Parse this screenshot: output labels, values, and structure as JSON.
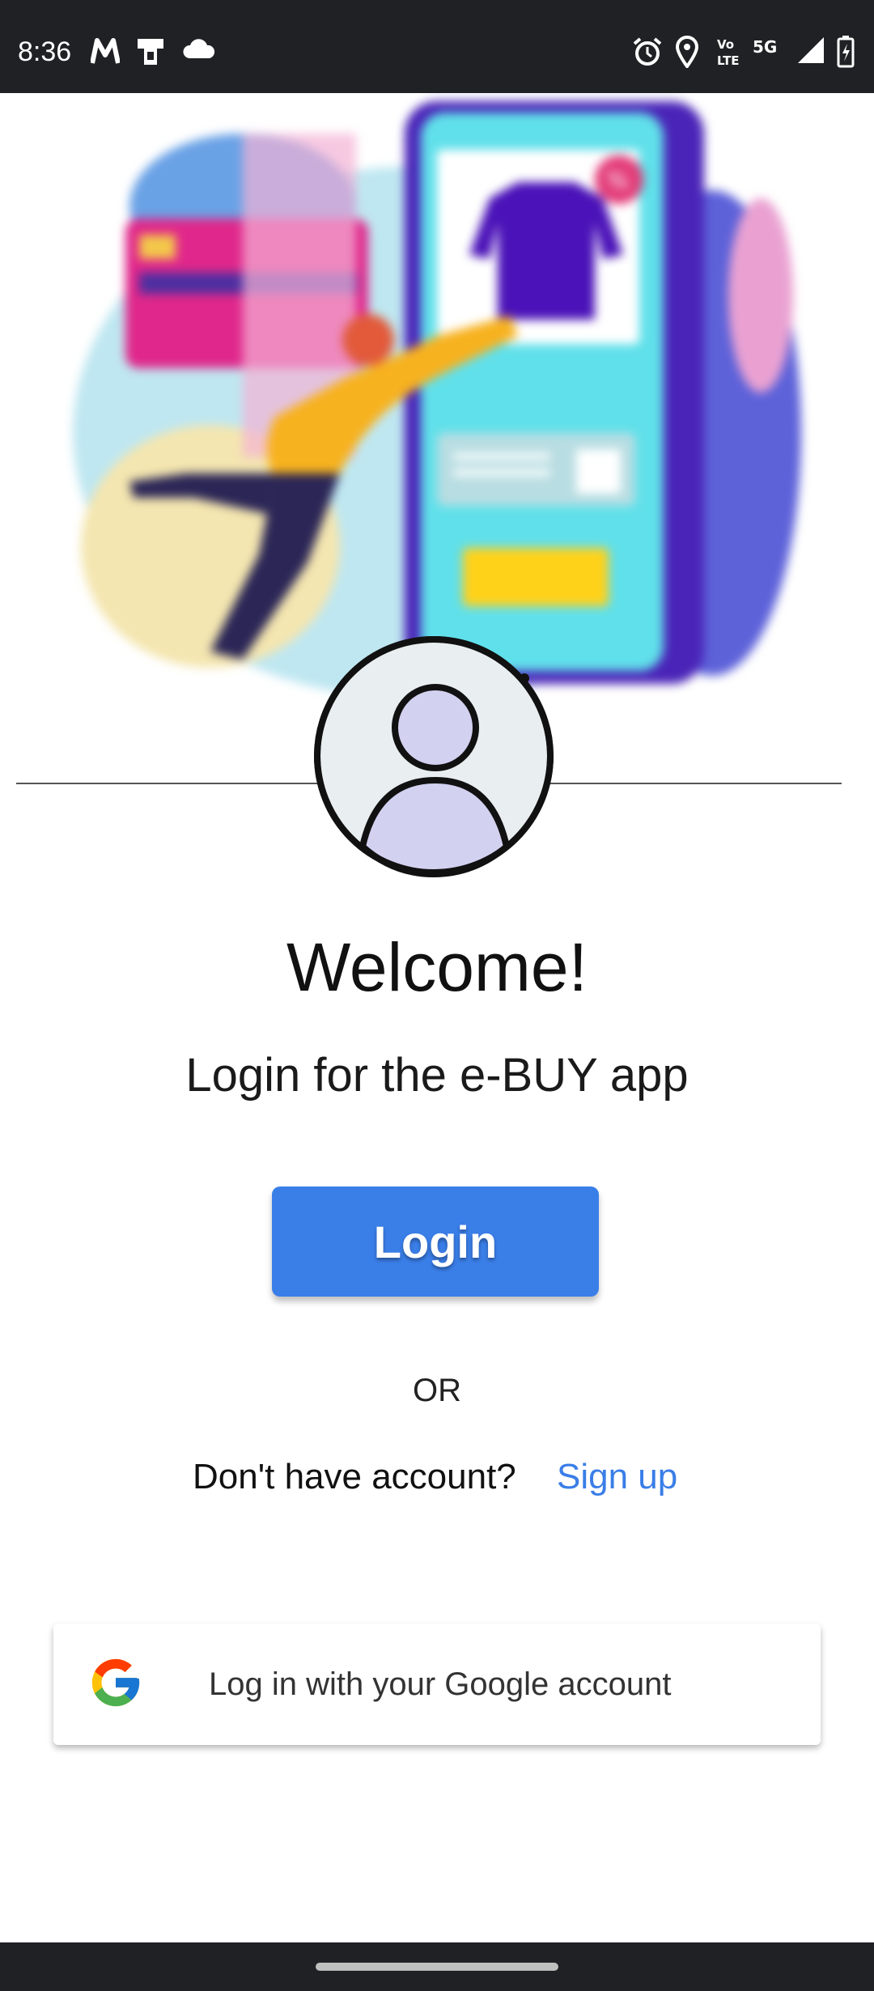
{
  "status_bar": {
    "time": "8:36",
    "left_icons": [
      "motorola-icon",
      "notification-icon",
      "cloud-icon"
    ],
    "right_icons": [
      "alarm-icon",
      "location-icon",
      "volte-icon",
      "5g-icon",
      "signal-icon",
      "battery-charging-icon"
    ],
    "network_label": "5G"
  },
  "hero": {
    "illustration": "shopping-phone-illustration"
  },
  "avatar": {
    "icon": "user-avatar-icon"
  },
  "welcome": {
    "title": "Welcome!",
    "subtitle": "Login for the e-BUY app"
  },
  "actions": {
    "login_label": "Login",
    "or_label": "OR",
    "no_account_text": "Don't have account?",
    "signup_label": "Sign up",
    "google_label": "Log in with your Google account"
  },
  "colors": {
    "accent": "#3a7ee8",
    "status_bar_bg": "#202124"
  }
}
